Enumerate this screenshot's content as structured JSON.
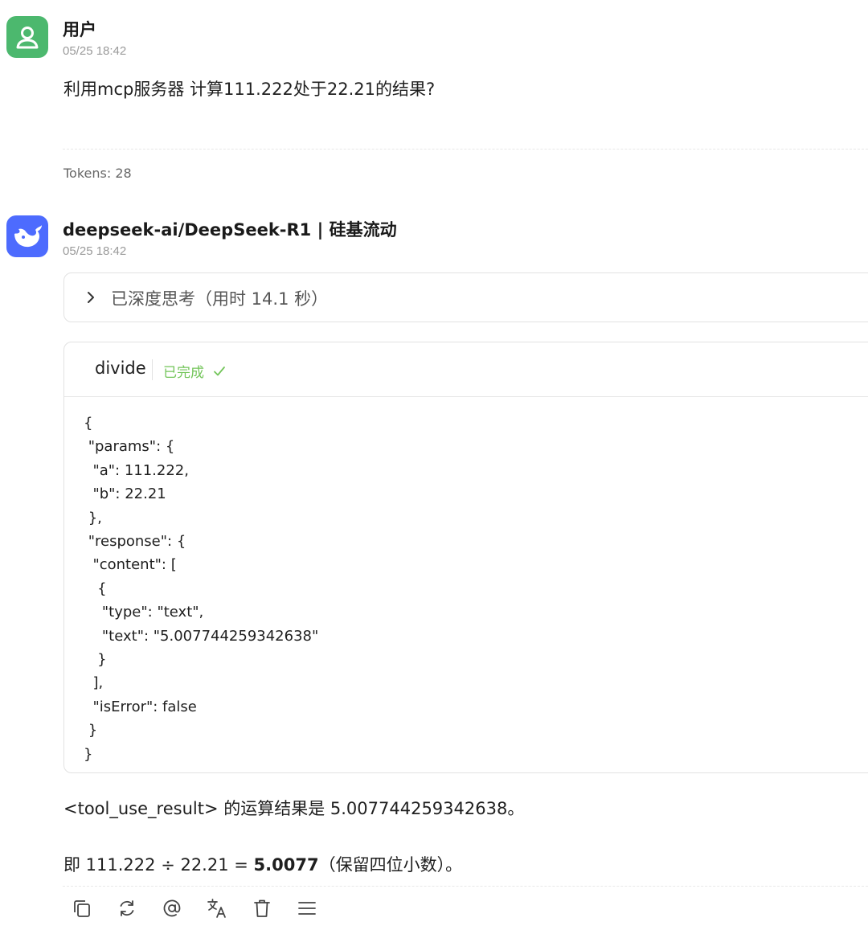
{
  "messages": [
    {
      "role": "user",
      "name": "用户",
      "time": "05/25 18:42",
      "text": "利用mcp服务器 计算111.222处于22.21的结果?",
      "tokens": "Tokens: 28"
    },
    {
      "role": "assistant",
      "name": "deepseek-ai/DeepSeek-R1 | 硅基流动",
      "time": "05/25 18:42",
      "thinking_label": "已深度思考（用时 14.1 秒）",
      "tool": {
        "name": "divide",
        "status": "已完成",
        "code": "{\n \"params\": {\n  \"a\": 111.222,\n  \"b\": 22.21\n },\n \"response\": {\n  \"content\": [\n   {\n    \"type\": \"text\",\n    \"text\": \"5.007744259342638\"\n   }\n  ],\n  \"isError\": false\n }\n}"
      },
      "result_line1": "<tool_use_result> 的运算结果是 5.007744259342638。",
      "result_line2_prefix": "即 111.222 ÷ 22.21 = ",
      "result_line2_bold": "5.0077",
      "result_line2_suffix": "（保留四位小数）。"
    }
  ],
  "icons": {
    "user_avatar": "user-icon",
    "bot_avatar": "whale-icon",
    "think_toggle": "chevron-right-icon",
    "status": "check-icon",
    "actions": [
      "copy-icon",
      "regenerate-icon",
      "mention-icon",
      "translate-icon",
      "delete-icon",
      "menu-icon"
    ]
  },
  "colors": {
    "user_avatar_bg": "#4cb86e",
    "bot_avatar_bg": "#4d6bfe",
    "status_green": "#73c55a"
  }
}
